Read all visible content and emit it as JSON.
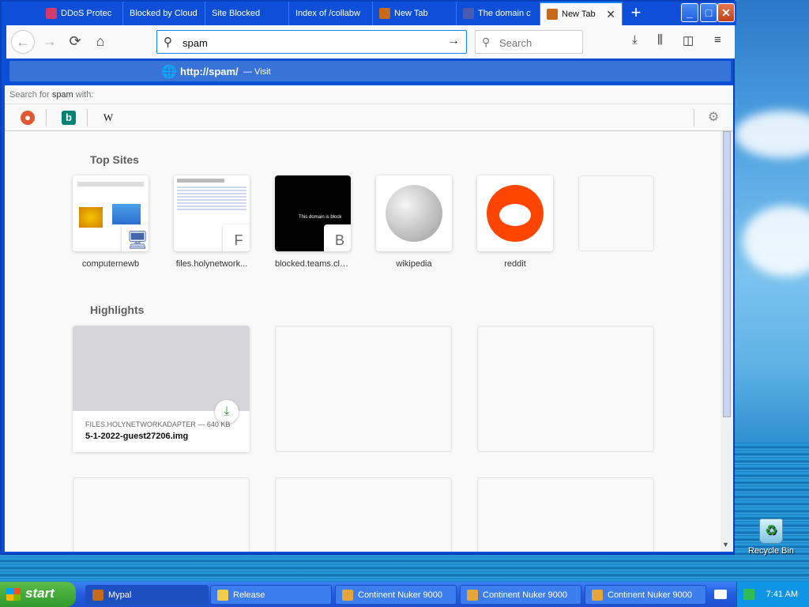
{
  "browser": {
    "tabs": [
      {
        "label": "DDoS Protec",
        "icon": "shield-icon",
        "color": "#d23b6b"
      },
      {
        "label": "Blocked by Cloud",
        "icon": "cloud-icon",
        "color": "#f48120"
      },
      {
        "label": "Site Blocked",
        "icon": "blocked-icon",
        "color": "#888888"
      },
      {
        "label": "Index of /collabw",
        "icon": "folder-icon",
        "color": "#888888"
      },
      {
        "label": "New Tab",
        "icon": "mypal-icon",
        "color": "#c86a1c"
      },
      {
        "label": "The domain c",
        "icon": "domain-icon",
        "color": "#4a5ab0"
      },
      {
        "label": "New Tab",
        "icon": "mypal-icon",
        "color": "#c86a1c"
      }
    ],
    "url_value": "spam",
    "search_placeholder": "Search",
    "suggestion": {
      "url": "http://spam/",
      "visit": "— Visit"
    },
    "search_with": {
      "prefix": "Search for",
      "term": "spam",
      "suffix": "with:"
    }
  },
  "newtab": {
    "top_sites_title": "Top Sites",
    "top_sites": [
      {
        "label": "computernewb",
        "badge": ""
      },
      {
        "label": "files.holynetwork...",
        "badge": "F"
      },
      {
        "label": "blocked.teams.clo...",
        "badge": "B"
      },
      {
        "label": "wikipedia",
        "badge": ""
      },
      {
        "label": "reddit",
        "badge": ""
      }
    ],
    "blocked_preview_text": "This domain is block",
    "highlights_title": "Highlights",
    "highlight": {
      "meta": "FILES.HOLYNETWORKADAPTER — 640 KB",
      "name": "5-1-2022-guest27206.img"
    }
  },
  "taskbar": {
    "start": "start",
    "items": [
      {
        "label": "Mypal",
        "active": true
      },
      {
        "label": "Release",
        "active": false
      },
      {
        "label": "Continent Nuker 9000",
        "active": false
      },
      {
        "label": "Continent Nuker 9000",
        "active": false
      },
      {
        "label": "Continent Nuker 9000",
        "active": false
      }
    ],
    "clock": "7:41 AM"
  },
  "desktop": {
    "recycle_bin": "Recycle Bin"
  },
  "colors": {
    "accent": "#0a84ff",
    "xp_blue": "#245ce0",
    "start_green": "#2f9a2d",
    "reddit": "#ff4500"
  }
}
